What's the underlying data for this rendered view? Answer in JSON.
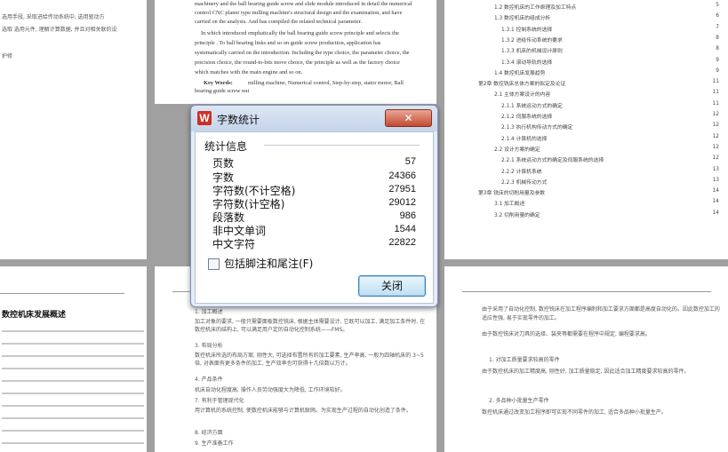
{
  "dialog": {
    "title": "字数统计",
    "icon_letter": "W",
    "close_symbol": "✕",
    "section_label": "统计信息",
    "stats": [
      {
        "label": "页数",
        "value": "57"
      },
      {
        "label": "字数",
        "value": "24366"
      },
      {
        "label": "字符数(不计空格)",
        "value": "27951"
      },
      {
        "label": "字符数(计空格)",
        "value": "29012"
      },
      {
        "label": "段落数",
        "value": "986"
      },
      {
        "label": "非中文单词",
        "value": "1544"
      },
      {
        "label": "中文字符",
        "value": "22822"
      }
    ],
    "footnote_checkbox": {
      "label": "包括脚注和尾注(F)",
      "checked": false
    },
    "close_button": "关闭"
  },
  "background": {
    "abstract_lines": [
      "machinery and the ball bearing guide screw and slide module introduced in detail the numerical",
      "control CNC planer type milling machine's structural design and the examination, and have",
      "carried on the analysis. And has compiled the related technical parameter.",
      "In which introduced emphatically the ball bearing guide screw principle and selects the",
      "principle . To ball bearing links and so on guide screw production, application has",
      "systematically carried on the introduction. Including the type choice, the parameter choice, the",
      "precision choice, the round-to-bits move choice, the principle as well as the factory choice",
      "which matches with the main engine and so on."
    ],
    "keywords_label": "Key Words:",
    "keywords": "milling machine, Numerical control, Step-by-step, stator motor, Ball",
    "keywords_cont": "bearing guide screw nut",
    "left_heading": "数控机床发展概述",
    "left_top_lines": [
      "选用手段, 采取进给传动系统中, 选用驱动方",
      "选取 选用元件, 理解计算数据, 并且对相关联的设",
      "护修"
    ],
    "toc": [
      {
        "text": "1.2 数控机床的工作原理及加工特点",
        "page": "5"
      },
      {
        "text": "1.3 数控机床的组成分析",
        "page": "6"
      },
      {
        "text": "1.3.1 控制系统的选择",
        "page": "7"
      },
      {
        "text": "1.3.2 进给传动系统的要求",
        "page": "8"
      },
      {
        "text": "1.3.3 机床的机械设计原则",
        "page": "8"
      },
      {
        "text": "1.3.4 滚动导轨的选择",
        "page": "9"
      },
      {
        "text": "1.4 数控机床发展趋势",
        "page": "9"
      },
      {
        "text": "第2章 数控铣床总体方案的拟定及论证",
        "page": "11"
      },
      {
        "text": "2.1 主体方案设计的内容",
        "page": "11"
      },
      {
        "text": "2.1.1 系统运动方式的确定",
        "page": "11"
      },
      {
        "text": "2.1.2 伺服系统的选择",
        "page": "12"
      },
      {
        "text": "2.1.3 执行机构传动方式的确定",
        "page": "12"
      },
      {
        "text": "2.1.4 计算机的选择",
        "page": "12"
      },
      {
        "text": "2.2 设计方案的确定",
        "page": "12"
      },
      {
        "text": "2.2.1 系统运动方式的确定及伺服系统的选择",
        "page": "12"
      },
      {
        "text": "2.2.2 计算机系统",
        "page": "13"
      },
      {
        "text": "2.2.3 机械传动方式",
        "page": "13"
      },
      {
        "text": "第3章 铣床的切削用量及参数",
        "page": "14"
      },
      {
        "text": "3.1 加工概述",
        "page": "14"
      },
      {
        "text": "3.2 切削用量的确定",
        "page": "14"
      }
    ],
    "center_bottom_lines": [
      "1. 加工概述",
      "加工对象的要求, 一般只需要面板数控铣床, 根据主体需要设计, 它既可以加工, 满足加工条件时, 在数控机床的结构上, 可以满足用户定的自动化控制系统——FMS。",
      "3. 布局分析",
      "数控机床所选的布局方案, 刚性大, 可选择布置所有的加工要素, 生产率高, 一般为四轴机床的 3~5 倍, 对表面有更多条件的加工, 生产效率也可获得十几倍数以万计。",
      "4. 产品条件",
      "机床自动化程度高, 操作人员劳动强度大为降低, 工作环境较好。",
      "7. 有利于管理现代化",
      "用计算机的系统控制, 使数控机床能够与计算机联网。为实现生产过程的自动化创造了条件。",
      "8. 经济方面",
      "9. 生产准备工作"
    ],
    "right_bottom_lines": [
      "由于采用了自动化控制, 数控铣床在加工程序编制和加工要求方面都是高度自动化的。因此数控加工的适应性强, 易于实现零件的加工。",
      "由于数控铣床对刀具的选择、装夹等都需要在程序中规定, 编程要求高。",
      "1. 对加工质量要求较高的零件",
      "由于数控机床的加工精度高, 刚性好, 加工质量稳定, 因此适合加工精度要求较高的零件。",
      "2. 多品种小批量生产零件",
      "数控机床通过改变加工程序即可实现不同零件的加工, 适合多品种小批量生产。"
    ]
  }
}
